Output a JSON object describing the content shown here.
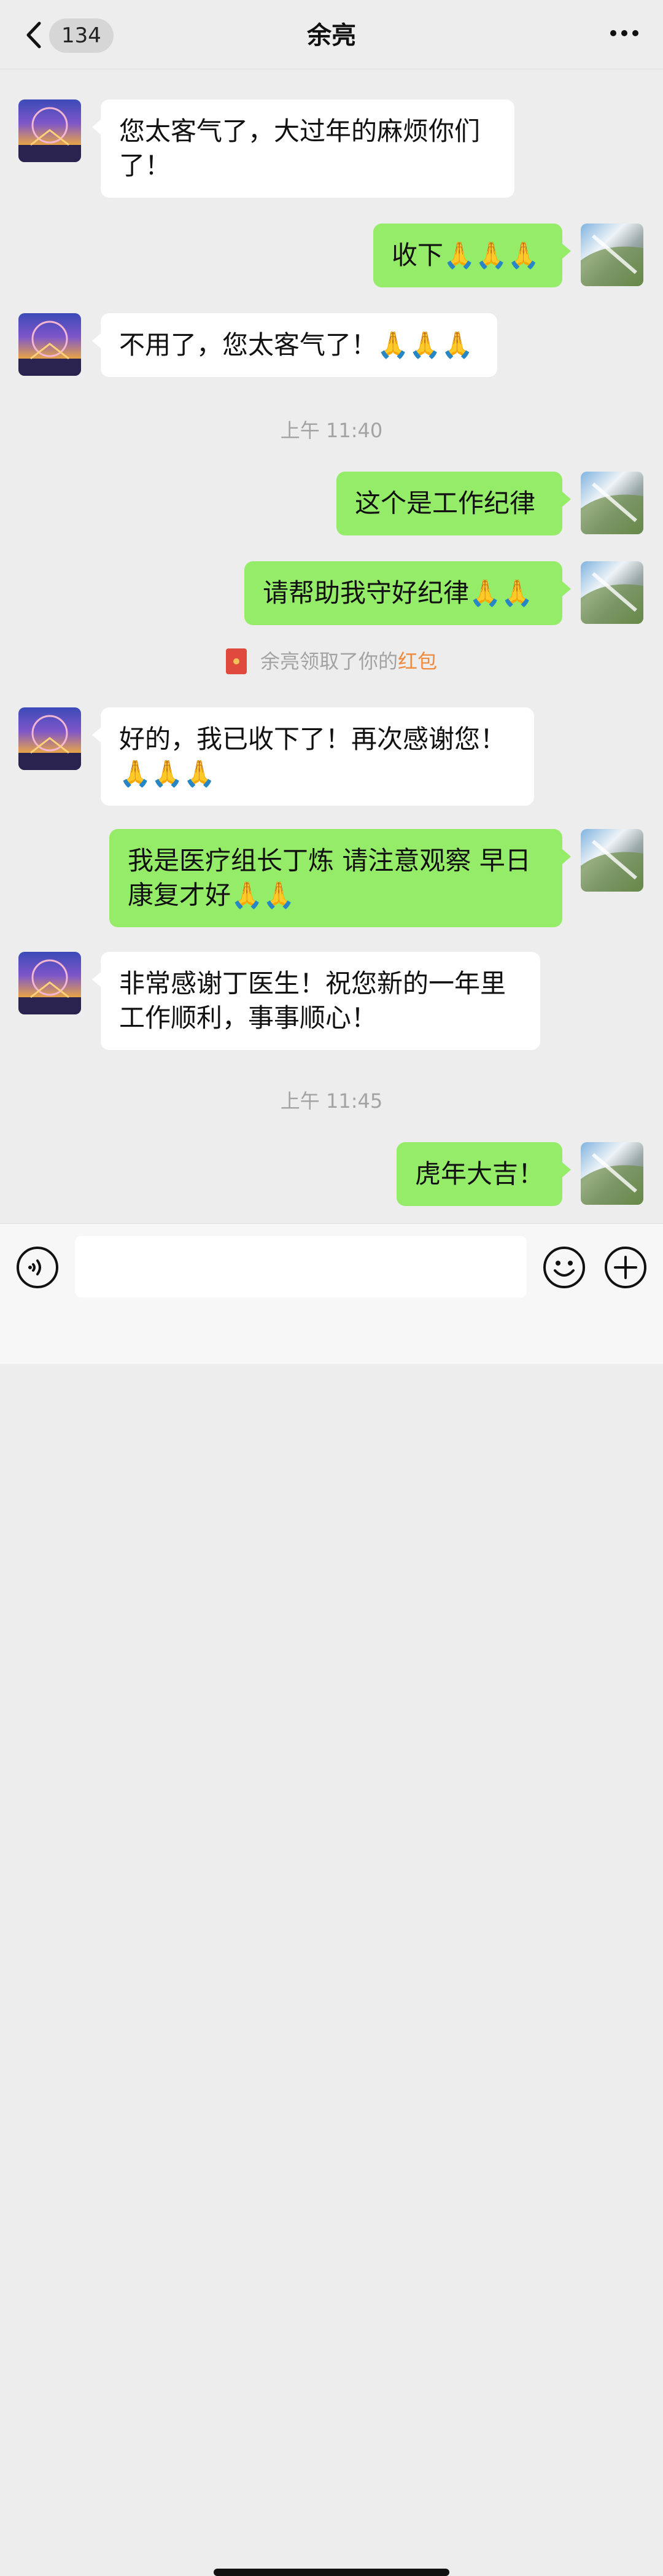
{
  "header": {
    "back_count": "134",
    "title": "余亮"
  },
  "messages": [
    {
      "side": "in",
      "lines": [
        "您太客气了，大过年的麻烦你们",
        "了！"
      ]
    },
    {
      "side": "out",
      "lines": [
        "收下🙏🙏🙏"
      ]
    },
    {
      "side": "in",
      "lines": [
        "不用了，您太客气了！🙏🙏🙏"
      ]
    },
    {
      "side": "out",
      "lines": [
        "这个是工作纪律"
      ]
    },
    {
      "side": "out",
      "lines": [
        "请帮助我守好纪律🙏🙏"
      ]
    },
    {
      "side": "in",
      "lines": [
        "好的，我已收下了！再次感谢您！",
        "🙏🙏🙏"
      ]
    },
    {
      "side": "out",
      "lines": [
        "我是医疗组长丁炼 请注意观察 早日",
        "康复才好🙏🙏"
      ]
    },
    {
      "side": "in",
      "lines": [
        "非常感谢丁医生！祝您新的一年里",
        "工作顺利，事事顺心！"
      ]
    },
    {
      "side": "out",
      "lines": [
        "虎年大吉！"
      ]
    }
  ],
  "timestamps": [
    "上午 11:40",
    "上午 11:45"
  ],
  "notice": {
    "text": "余亮领取了你的",
    "highlight": "红包",
    "highlight_color": "#f08a3c"
  },
  "colors": {
    "outgoing_bubble": "#95ec69",
    "incoming_bubble": "#ffffff",
    "background": "#ededed"
  },
  "inputbar": {
    "icons": [
      "voice-icon",
      "emoji-icon",
      "plus-icon"
    ]
  }
}
